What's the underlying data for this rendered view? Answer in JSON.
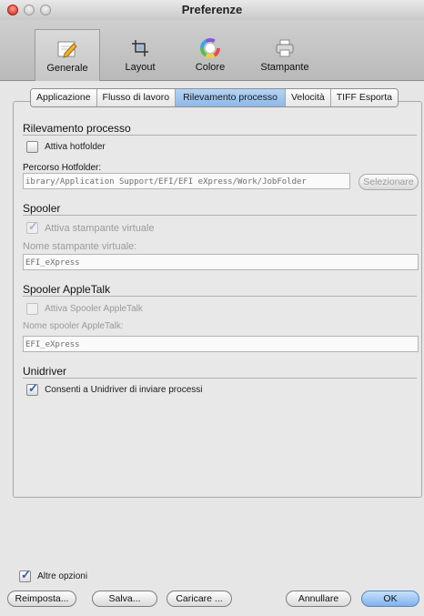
{
  "window": {
    "title": "Preferenze"
  },
  "toolbar": {
    "items": [
      {
        "label": "Generale",
        "icon": "pencil-document-icon"
      },
      {
        "label": "Layout",
        "icon": "crop-layout-icon"
      },
      {
        "label": "Colore",
        "icon": "color-wheel-icon"
      },
      {
        "label": "Stampante",
        "icon": "printer-icon"
      }
    ],
    "selected": "Generale"
  },
  "tabs": [
    {
      "label": "Applicazione"
    },
    {
      "label": "Flusso di lavoro"
    },
    {
      "label": "Rilevamento processo"
    },
    {
      "label": "Velocità"
    },
    {
      "label": "TIFF Esporta"
    }
  ],
  "active_tab": "Rilevamento processo",
  "rilevamento": {
    "title": "Rilevamento processo",
    "hotfolder_checkbox": "Attiva hotfolder",
    "hotfolder_checked": false,
    "path_label": "Percorso Hotfolder:",
    "path_value": "ibrary/Application Support/EFI/EFI eXpress/Work/JobFolder",
    "select_button": "Selezionare"
  },
  "spooler": {
    "title": "Spooler",
    "virtual_checkbox": "Attiva stampante virtuale",
    "virtual_checked": true,
    "name_label": "Nome stampante virtuale:",
    "name_value": "EFI_eXpress"
  },
  "appletalk": {
    "title": "Spooler AppleTalk",
    "enable_checkbox": "Attiva Spooler AppleTalk",
    "enable_checked": false,
    "name_label": "Nome spooler AppleTalk:",
    "name_value": "EFI_eXpress"
  },
  "unidriver": {
    "title": "Unidriver",
    "allow_checkbox": "Consenti a Unidriver di inviare processi",
    "allow_checked": true
  },
  "footer": {
    "more_options": "Altre opzioni",
    "more_options_checked": true,
    "reset_button": "Reimposta...",
    "save_button": "Salva...",
    "load_button": "Caricare ...",
    "cancel_button": "Annullare",
    "ok_button": "OK"
  },
  "colors": {
    "accent": "#8db8e8",
    "check": "#2a5fb0"
  }
}
